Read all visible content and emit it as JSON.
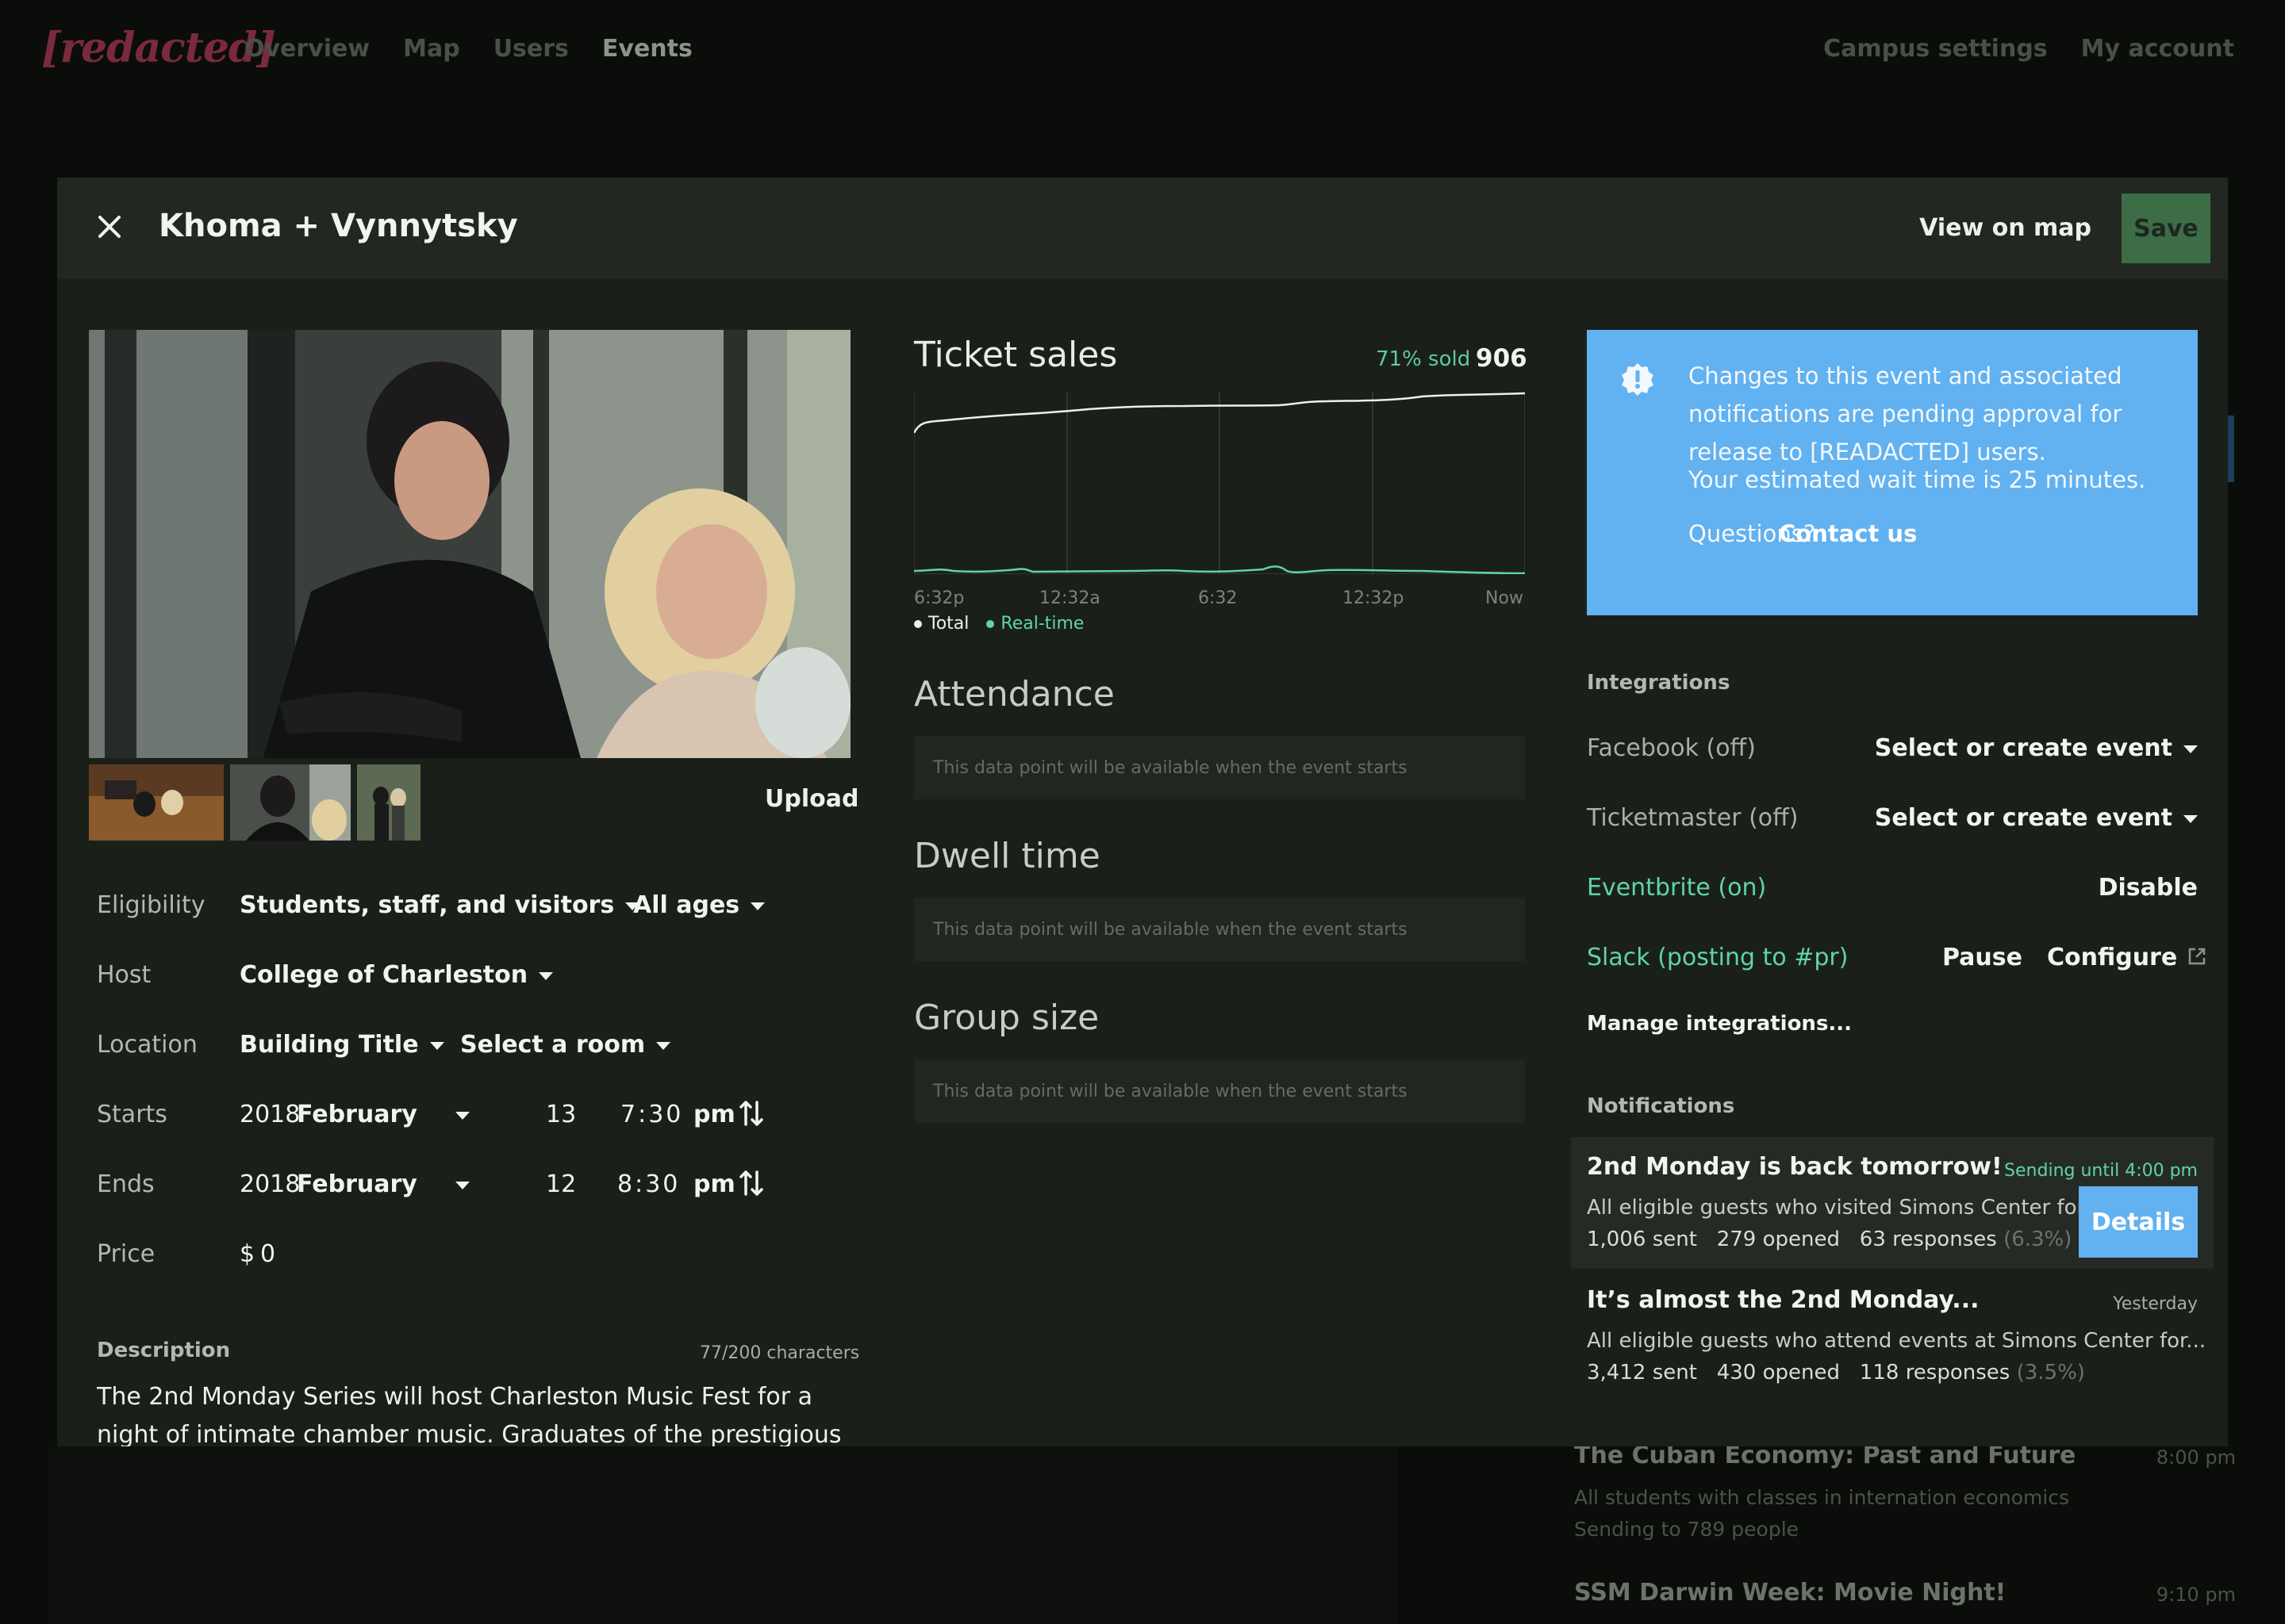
{
  "app": {
    "logo": "[redacted]",
    "nav": [
      "Overview",
      "Map",
      "Users",
      "Events"
    ],
    "nav_active": "Events",
    "nav_right": [
      "Campus settings",
      "My account"
    ]
  },
  "background_list": [
    {
      "title": "The Cuban Economy: Past and Future",
      "time": "8:00 pm",
      "sub1": "All students with classes in internation economics",
      "sub2": "Sending to 789 people"
    },
    {
      "title": "SSM Darwin Week: Movie Night!",
      "time": "9:10 pm"
    }
  ],
  "modal": {
    "title": "Khoma + Vynnytsky",
    "view_on_map": "View on map",
    "save": "Save",
    "upload": "Upload",
    "form": {
      "eligibility_label": "Eligibility",
      "eligibility_value": "Students, staff, and visitors",
      "age_value": "All ages",
      "host_label": "Host",
      "host_value": "College of Charleston",
      "location_label": "Location",
      "building_value": "Building Title",
      "room_value": "Select a room",
      "starts_label": "Starts",
      "starts": {
        "year": "2018",
        "month": "February",
        "day": "13",
        "time": "7:30",
        "ampm": "pm"
      },
      "ends_label": "Ends",
      "ends": {
        "year": "2018",
        "month": "February",
        "day": "12",
        "time": "8:30",
        "ampm": "pm"
      },
      "price_label": "Price",
      "price_currency": "$",
      "price_value": "0"
    },
    "description": {
      "label": "Description",
      "count": "77/200 characters",
      "text": "The 2nd Monday Series will host Charleston Music Fest for a night of intimate chamber music. Graduates of the prestigious"
    },
    "ticket_sales": {
      "title": "Ticket sales",
      "pct_sold": "71% sold",
      "total": "906",
      "ticks": [
        "6:32p",
        "12:32a",
        "6:32",
        "12:32p",
        "Now"
      ],
      "legend_total": "Total",
      "legend_realtime": "Real-time",
      "total_color": "#eef0ec",
      "realtime_color": "#5ed5a6"
    },
    "metrics": [
      {
        "title": "Attendance",
        "placeholder": "This data point will be available when the event starts"
      },
      {
        "title": "Dwell time",
        "placeholder": "This data point will be available when the event starts"
      },
      {
        "title": "Group size",
        "placeholder": "This data point will be available when the event starts"
      }
    ],
    "alert": {
      "text": "Changes to this event and associated notifications are pending approval for release to [READACTED] users.",
      "wait": "Your estimated wait time is 25 minutes.",
      "question": "Questions?",
      "contact": "Contact us",
      "bg_color": "#62b1f0"
    },
    "integrations": {
      "label": "Integrations",
      "facebook": {
        "name": "Facebook (off)",
        "action": "Select or create event"
      },
      "ticketmaster": {
        "name": "Ticketmaster (off)",
        "action": "Select or create event"
      },
      "eventbrite": {
        "name": "Eventbrite (on)",
        "action": "Disable"
      },
      "slack": {
        "name": "Slack (posting to #pr)",
        "pause": "Pause",
        "configure": "Configure"
      },
      "manage": "Manage integrations..."
    },
    "notifications": {
      "label": "Notifications",
      "items": [
        {
          "title": "2nd Monday is back tomorrow!",
          "status": "Sending until 4:00 pm",
          "sub": "All eligible guests who visited Simons Center for",
          "sent": "1,006 sent",
          "opened": "279 opened",
          "responses": "63 responses",
          "pct": "(6.3%)",
          "details": "Details"
        },
        {
          "title": "It’s almost the 2nd Monday...",
          "status": "Yesterday",
          "sub": "All eligible guests who attend events at Simons Center for...",
          "sent": "3,412 sent",
          "opened": "430 opened",
          "responses": "118 responses",
          "pct": "(3.5%)"
        }
      ]
    }
  }
}
